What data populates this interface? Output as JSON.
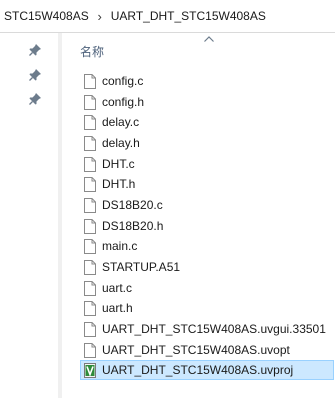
{
  "breadcrumb": {
    "items": [
      "STC15W408AS",
      "UART_DHT_STC15W408AS"
    ],
    "separator": "›"
  },
  "nav": {
    "pins": [
      "pin-icon",
      "pin-icon",
      "pin-icon"
    ]
  },
  "filelist": {
    "column_header": "名称",
    "sort": "ascending",
    "files": [
      {
        "name": "config.c",
        "icon": "generic-file-icon"
      },
      {
        "name": "config.h",
        "icon": "generic-file-icon"
      },
      {
        "name": "delay.c",
        "icon": "generic-file-icon"
      },
      {
        "name": "delay.h",
        "icon": "generic-file-icon"
      },
      {
        "name": "DHT.c",
        "icon": "generic-file-icon"
      },
      {
        "name": "DHT.h",
        "icon": "generic-file-icon"
      },
      {
        "name": "DS18B20.c",
        "icon": "generic-file-icon"
      },
      {
        "name": "DS18B20.h",
        "icon": "generic-file-icon"
      },
      {
        "name": "main.c",
        "icon": "generic-file-icon"
      },
      {
        "name": "STARTUP.A51",
        "icon": "generic-file-icon"
      },
      {
        "name": "uart.c",
        "icon": "generic-file-icon"
      },
      {
        "name": "uart.h",
        "icon": "generic-file-icon"
      },
      {
        "name": "UART_DHT_STC15W408AS.uvgui.33501",
        "icon": "generic-file-icon"
      },
      {
        "name": "UART_DHT_STC15W408AS.uvopt",
        "icon": "generic-file-icon"
      },
      {
        "name": "UART_DHT_STC15W408AS.uvproj",
        "icon": "keil-project-icon",
        "selected": true
      }
    ]
  },
  "colors": {
    "selection_fill": "#cce8ff",
    "selection_border": "#99d1ff",
    "header_text": "#4c607a",
    "keil_green": "#2e8b3a"
  }
}
